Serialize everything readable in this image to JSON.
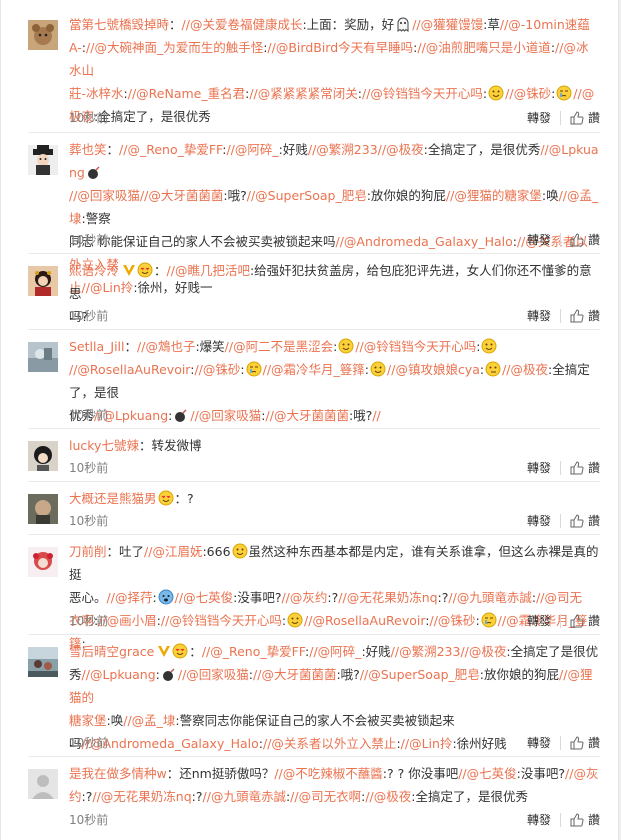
{
  "actions": {
    "repost": "轉發",
    "like": "讚"
  },
  "comments": [
    {
      "time": "10秒前",
      "line1": [
        "當第七號橋毀掉時",
        "：",
        "//@关爱卷福健康成长",
        ":上面：奖励，好",
        "//",
        "@獾獾馒馒",
        ":草",
        "//",
        "@-10min速蕴"
      ],
      "line2": [
        "A-",
        ":",
        "//@大碗神面_为爱而生的触手怪",
        ":",
        "//@BirdBird今天有早睡吗",
        ":",
        "//@油煎肥嘴只是小道道",
        ":",
        "//@冰水山"
      ],
      "line3": [
        "莊-冰梓水",
        ":",
        "//@ReName_重名君",
        ":",
        "//@紧紧紧紧常闭关",
        ":",
        "//@铃铛铛今天开心吗",
        ":",
        "//@铢砂",
        ":",
        "//@"
      ],
      "line4": [
        "极夜",
        ":全搞定了，是很优秀"
      ]
    },
    {
      "time": "10秒前",
      "line1": [
        "葬也笑",
        "：",
        "//@_Reno_挚爱FF",
        ":",
        "//@阿碎_",
        ":好贱",
        "//@繁溯233",
        "//@极夜",
        ":全搞定了，是很优秀",
        "//@Lpkuang",
        ":"
      ],
      "line2": [
        "//@回家吸猫",
        "//@大牙菌菌菌",
        ":哦?",
        "//@SuperSoap_肥皂",
        ":放你娘的狗屁",
        "//@狸猫的糖家堡",
        ":唤",
        "//@孟_埭",
        ":警察"
      ],
      "line3": [
        "同志 你能保证自己的家人不会被买卖被锁起来吗",
        "//@Andromeda_Galaxy_Halo",
        ":",
        "//@关系者以外立入禁"
      ],
      "line4": [
        "止",
        "//@Lin拎",
        ":徐州，好贱一"
      ]
    },
    {
      "time": "10秒前",
      "line1": [
        "熙语泠泠",
        "：",
        "//@瞧几把活吧",
        ":给强奸犯扶贫盖房，给包庇犯评先进，女人们你还不懂爹的意思"
      ],
      "line2": [
        "吗?"
      ]
    },
    {
      "time": "10秒前",
      "line1": [
        "Setlla_Jill",
        "：",
        "//@鴆也子",
        ":爆笑",
        "//@阿二不是黑涩会",
        ":",
        "//@铃铛铛今天开心吗",
        ":"
      ],
      "line2": [
        "//@RosellaAuRevoir",
        ":",
        "//@铢砂",
        ":",
        "//@霜冷华月_簦箨",
        ":",
        "//@镇攻娘娘cya",
        ":",
        "//@极夜",
        ":全搞定了，是很"
      ],
      "line3": [
        "优秀",
        "//@Lpkuang",
        ":",
        "//@回家吸猫",
        ":",
        "//@大牙菌菌菌",
        ":哦?",
        "//"
      ]
    },
    {
      "time": "10秒前",
      "line1": [
        "lucky七號辣",
        "：",
        "转发微博"
      ]
    },
    {
      "time": "10秒前",
      "line1": [
        "大概还是熊猫男",
        "：?"
      ]
    },
    {
      "time": "10秒前",
      "line1": [
        "刀前削",
        "：吐了",
        "//@江眉妩",
        ":666",
        "虽然这种东西基本都是内定，谁有关系谁拿，但这么赤裸是真的挺"
      ],
      "line2": [
        "恶心。",
        "//@择荇",
        ":",
        "//@七英俊",
        ":没事吧?",
        "//@灰约",
        ":?",
        "//@无花果奶冻nq",
        ":?",
        "//@九頭竜赤誠",
        ":",
        "//@司无"
      ],
      "line3": [
        "衣啊",
        ":",
        "//@画小眉",
        ":",
        "//@铃铛铛今天开心吗",
        ":",
        "//@RosellaAuRevoir",
        ":",
        "//@铢砂",
        ":",
        "//@霜冷华月_簦箨",
        ":"
      ]
    },
    {
      "time": "10秒前",
      "line1": [
        "雪后晴空grace",
        "：",
        "//@_Reno_挚爱FF",
        ":",
        "//@阿碎_",
        ":好贱",
        "//@繁溯233",
        "//@极夜",
        ":全搞定了是很优"
      ],
      "line2": [
        "秀",
        "//@Lpkuang",
        ":",
        "//@回家吸猫",
        ":",
        "//@大牙菌菌菌",
        ":哦?",
        "//@SuperSoap_肥皂",
        ":放你娘的狗屁",
        "//@狸猫的"
      ],
      "line3": [
        "糖家堡",
        ":唤",
        "//@孟_埭",
        ":警察同志你能保证自己的家人不会被买卖被锁起来"
      ],
      "line4": [
        "吗",
        "//@Andromeda_Galaxy_Halo",
        ":",
        "//@关系者以外立入禁止",
        ":",
        "//@Lin拎",
        ":徐州好贱"
      ]
    },
    {
      "time": "10秒前",
      "line1": [
        "是我在做多情种w",
        "：还nm挺骄傲吗？",
        "//@不吃辣椒不蘸醬",
        ":? ? 你没事吧",
        "//@七英俊",
        ":没事吧?",
        "//@灰"
      ],
      "line2": [
        "约",
        ":?",
        "//@无花果奶冻nq",
        ":?",
        "//@九頭竜赤誠",
        ":",
        "//@司无衣啊",
        ":",
        "//@极夜",
        ":全搞定了，是很优秀"
      ]
    }
  ]
}
